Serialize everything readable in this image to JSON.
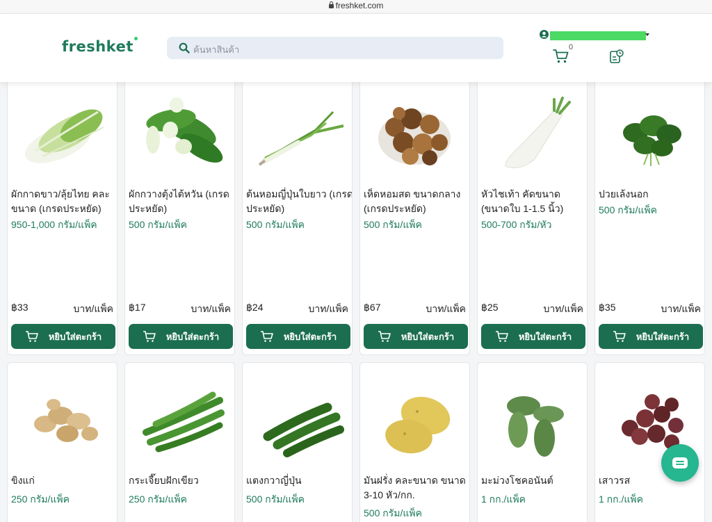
{
  "browser": {
    "url": "freshket.com"
  },
  "header": {
    "logo": "freshket",
    "search_placeholder": "ค้นหาสินค้า",
    "cart_count": "0"
  },
  "colors": {
    "brand": "#1e7b5a",
    "button": "#1b6e50",
    "chat": "#26b690",
    "search_bg": "#e8edf5"
  },
  "add_to_cart_label": "หยิบใส่ตะกร้า",
  "products": [
    {
      "name": "ผักกาดขาว/ลุ้ยไทย คละขนาด (เกรดประหยัด)",
      "size": "950-1,000 กรัม/แพ็ค",
      "price": "฿33",
      "unit": "บาท/แพ็ค",
      "image": "napa-cabbage"
    },
    {
      "name": "ผักกวางตุ้งไต้หวัน (เกรดประหยัด)",
      "size": "500 กรัม/แพ็ค",
      "price": "฿17",
      "unit": "บาท/แพ็ค",
      "image": "bok-choy"
    },
    {
      "name": "ต้นหอมญี่ปุ่นใบยาว (เกรดประหยัด)",
      "size": "500 กรัม/แพ็ค",
      "price": "฿24",
      "unit": "บาท/แพ็ค",
      "image": "japanese-leek"
    },
    {
      "name": "เห็ดหอมสด ขนาดกลาง (เกรดประหยัด)",
      "size": "500 กรัม/แพ็ค",
      "price": "฿67",
      "unit": "บาท/แพ็ค",
      "image": "shiitake"
    },
    {
      "name": "หัวไชเท้า คัดขนาด (ขนาดใบ 1-1.5 นิ้ว)",
      "size": "500-700 กรัม/หัว",
      "price": "฿25",
      "unit": "บาท/แพ็ค",
      "image": "daikon"
    },
    {
      "name": "ปวยเล้งนอก",
      "size": "500 กรัม/แพ็ค",
      "price": "฿35",
      "unit": "บาท/แพ็ค",
      "image": "spinach"
    },
    {
      "name": "ขิงแก่",
      "size": "250 กรัม/แพ็ค",
      "image": "ginger"
    },
    {
      "name": "กระเจี๊ยบฝักเขียว",
      "size": "250 กรัม/แพ็ค",
      "image": "okra"
    },
    {
      "name": "แตงกวาญี่ปุ่น",
      "size": "500 กรัม/แพ็ค",
      "image": "cucumber"
    },
    {
      "name": "มันฝรั่ง คละขนาด ขนาด 3-10 หัว/กก.",
      "size": "500 กรัม/แพ็ค",
      "image": "potato"
    },
    {
      "name": "มะม่วงโชคอนันต์",
      "size": "1 กก./แพ็ค",
      "image": "mango"
    },
    {
      "name": "เสาวรส",
      "size": "1 กก./แพ็ค",
      "image": "passion-fruit"
    }
  ]
}
